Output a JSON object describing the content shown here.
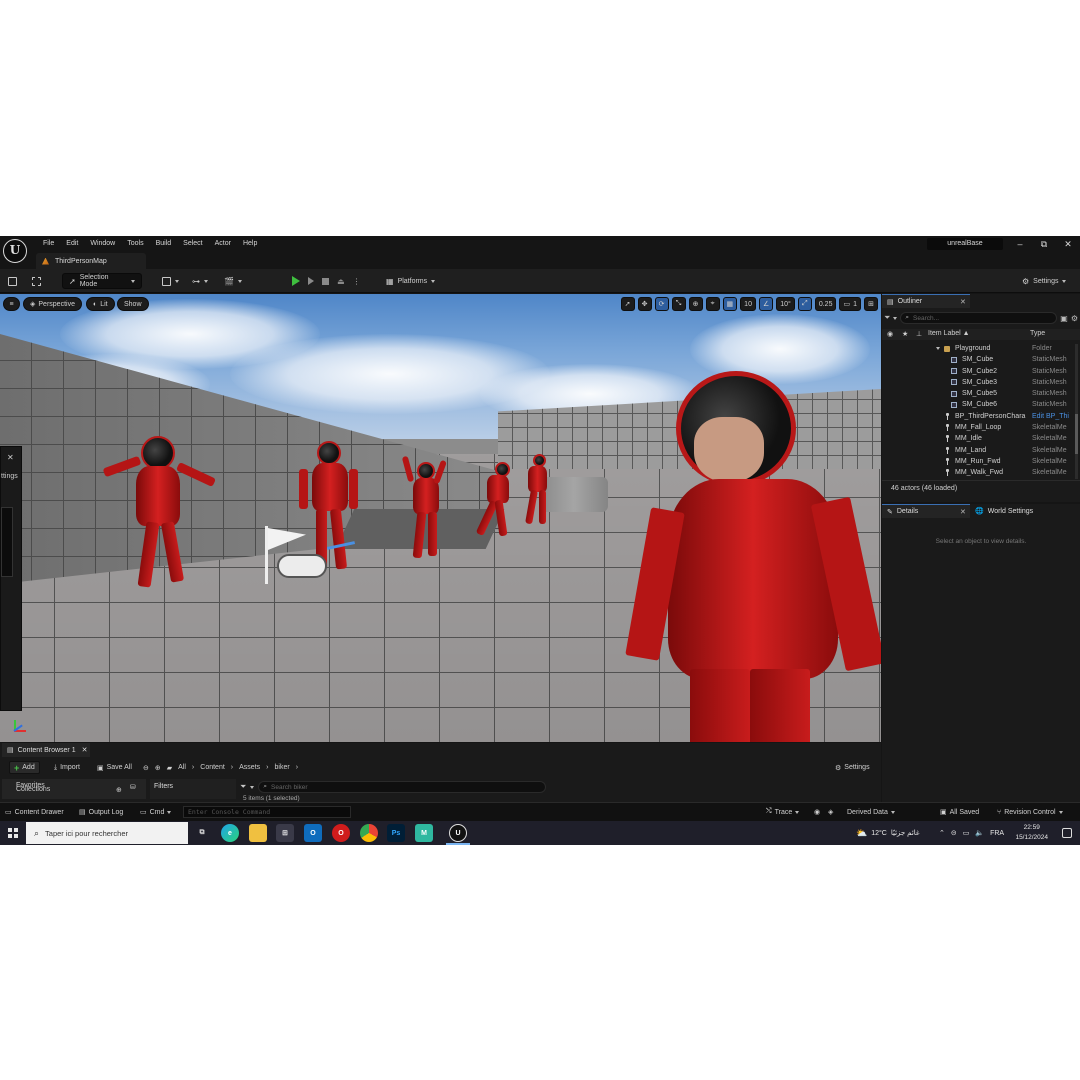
{
  "titlebar": {
    "menu": [
      "File",
      "Edit",
      "Window",
      "Tools",
      "Build",
      "Select",
      "Actor",
      "Help"
    ],
    "map_tab": "ThirdPersonMap",
    "project_name": "unrealBase",
    "win_minimize": "–",
    "win_restore": "⧉",
    "win_close": "✕"
  },
  "toolbar": {
    "selection_mode": "Selection Mode",
    "platforms": "Platforms",
    "settings": "Settings"
  },
  "viewport": {
    "perspective": "Perspective",
    "lit": "Lit",
    "show": "Show",
    "grid_snap": "10",
    "rotation_snap": "10°",
    "scale_snap": "0.25",
    "camera_speed": "1"
  },
  "left_panel": {
    "close": "✕",
    "label": "ttings"
  },
  "outliner": {
    "tab": "Outliner",
    "search_placeholder": "Search...",
    "col_label": "Item Label ▲",
    "col_type": "Type",
    "rows": [
      {
        "label": "Playground",
        "type": "Folder"
      },
      {
        "label": "SM_Cube",
        "type": "StaticMesh"
      },
      {
        "label": "SM_Cube2",
        "type": "StaticMesh"
      },
      {
        "label": "SM_Cube3",
        "type": "StaticMesh"
      },
      {
        "label": "SM_Cube5",
        "type": "StaticMesh"
      },
      {
        "label": "SM_Cube6",
        "type": "StaticMesh"
      },
      {
        "label": "BP_ThirdPersonChara",
        "type": "Edit BP_Thi"
      },
      {
        "label": "MM_Fall_Loop",
        "type": "SkeletalMe"
      },
      {
        "label": "MM_Idle",
        "type": "SkeletalMe"
      },
      {
        "label": "MM_Land",
        "type": "SkeletalMe"
      },
      {
        "label": "MM_Run_Fwd",
        "type": "SkeletalMe"
      },
      {
        "label": "MM_Walk_Fwd",
        "type": "SkeletalMe"
      }
    ],
    "actors_count": "46 actors (46 loaded)"
  },
  "details": {
    "tab_details": "Details",
    "tab_world": "World Settings",
    "empty_message": "Select an object to view details."
  },
  "content_browser": {
    "tab": "Content Browser 1",
    "add": "Add",
    "import": "Import",
    "save_all": "Save All",
    "path": [
      "All",
      "Content",
      "Assets",
      "biker"
    ],
    "settings": "Settings",
    "favorites": "Favorites",
    "collections": "Collections",
    "filters": "Filters",
    "search_placeholder": "Search biker",
    "item_count": "5 items (1 selected)"
  },
  "statusbar": {
    "content_drawer": "Content Drawer",
    "output_log": "Output Log",
    "cmd": "Cmd",
    "console_placeholder": "Enter Console Command",
    "trace": "Trace",
    "derived_data": "Derived Data",
    "all_saved": "All Saved",
    "revision_control": "Revision Control"
  },
  "taskbar": {
    "search_placeholder": "Taper ici pour rechercher",
    "weather": "12°C",
    "weather_label": "غائم جزئيًا",
    "language": "FRA",
    "time": "22:59",
    "date": "15/12/2024"
  }
}
